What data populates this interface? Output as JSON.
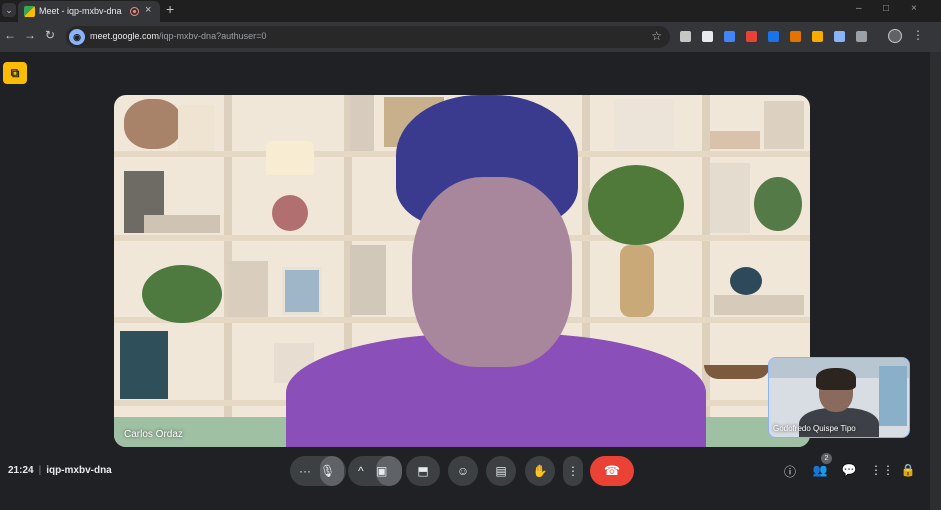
{
  "browser": {
    "tab_title": "Meet - iqp-mxbv-dna",
    "tab_close": "×",
    "new_tab": "+",
    "url_host": "meet.google.com",
    "url_path": "/iqp-mxbv-dna?authuser=0",
    "window_controls": [
      "–",
      "□",
      "×"
    ]
  },
  "meeting": {
    "time": "21:24",
    "code": "iqp-mxbv-dna",
    "main_participant": "Carlos Ordaz",
    "self_participant": "Godofredo Quispe Tipo",
    "participant_count": "2"
  },
  "controls": {
    "more_options": "···",
    "caret": "^",
    "more_actions": "⋮"
  },
  "colors": {
    "end_call": "#ea4335",
    "activity": "#fbbc04",
    "self_border": "#8ab4f8"
  }
}
